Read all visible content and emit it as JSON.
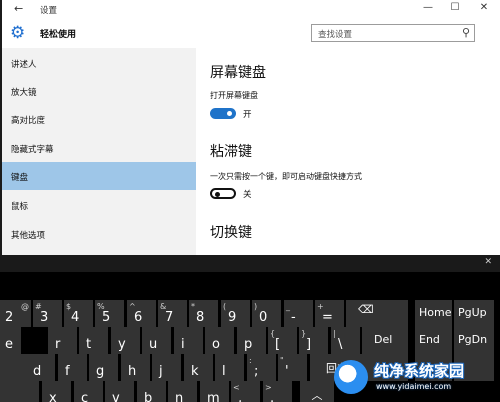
{
  "window": {
    "back_icon": "back-arrow-icon",
    "title": "设置",
    "minimize": "—",
    "maximize": "☐",
    "close": "✕"
  },
  "header": {
    "section_icon": "gear-icon",
    "section_title": "轻松使用"
  },
  "search": {
    "placeholder": "查找设置",
    "icon": "search-icon"
  },
  "sidebar": {
    "items": [
      {
        "label": "讲述人",
        "active": false
      },
      {
        "label": "放大镜",
        "active": false
      },
      {
        "label": "高对比度",
        "active": false
      },
      {
        "label": "隐藏式字幕",
        "active": false
      },
      {
        "label": "键盘",
        "active": true
      },
      {
        "label": "鼠标",
        "active": false
      },
      {
        "label": "其他选项",
        "active": false
      }
    ]
  },
  "content": {
    "onscreen_keyboard": {
      "heading": "屏幕键盘",
      "setting_label": "打开屏幕键盘",
      "state": "开",
      "on": true
    },
    "sticky_keys": {
      "heading": "粘滞键",
      "setting_label": "一次只需按一个键，即可启动键盘快捷方式",
      "state": "关",
      "on": false
    },
    "toggle_keys": {
      "heading": "切换键"
    }
  },
  "keyboard": {
    "close": "✕",
    "row1": [
      {
        "main": "2",
        "shift": "@"
      },
      {
        "main": "3",
        "shift": "#"
      },
      {
        "main": "4",
        "shift": "$"
      },
      {
        "main": "5",
        "shift": "%"
      },
      {
        "main": "6",
        "shift": "^"
      },
      {
        "main": "7",
        "shift": "&"
      },
      {
        "main": "8",
        "shift": "*"
      },
      {
        "main": "9",
        "shift": "("
      },
      {
        "main": "0",
        "shift": ")"
      },
      {
        "main": "-",
        "shift": "_"
      },
      {
        "main": "=",
        "shift": "+"
      }
    ],
    "backspace": "⌫",
    "row2": [
      {
        "main": "e"
      },
      {
        "main": "r"
      },
      {
        "main": "t"
      },
      {
        "main": "y"
      },
      {
        "main": "u"
      },
      {
        "main": "i"
      },
      {
        "main": "o"
      },
      {
        "main": "p"
      },
      {
        "main": "[",
        "shift": "{"
      },
      {
        "main": "]",
        "shift": "}"
      },
      {
        "main": "\\",
        "shift": "|"
      }
    ],
    "row3": [
      {
        "main": "d"
      },
      {
        "main": "f"
      },
      {
        "main": "g"
      },
      {
        "main": "h"
      },
      {
        "main": "j"
      },
      {
        "main": "k"
      },
      {
        "main": "l"
      },
      {
        "main": ";",
        "shift": ":"
      },
      {
        "main": "'",
        "shift": "\""
      }
    ],
    "row4": [
      {
        "main": "x"
      },
      {
        "main": "c"
      },
      {
        "main": "v"
      },
      {
        "main": "b"
      },
      {
        "main": "n"
      },
      {
        "main": "m"
      },
      {
        "main": ",",
        "shift": "<"
      },
      {
        "main": ".",
        "shift": ">"
      }
    ],
    "nav": {
      "home": "Home",
      "pgup": "PgUp",
      "del": "Del",
      "end": "End",
      "pgdn": "PgDn",
      "enter": "回车"
    }
  },
  "watermark": {
    "brand": "纯净系统家园",
    "url": "www.yidaimei.com"
  },
  "colors": {
    "accent": "#1f73c9",
    "sidebar_active": "#9ec6e8",
    "key_bg": "#333333"
  }
}
